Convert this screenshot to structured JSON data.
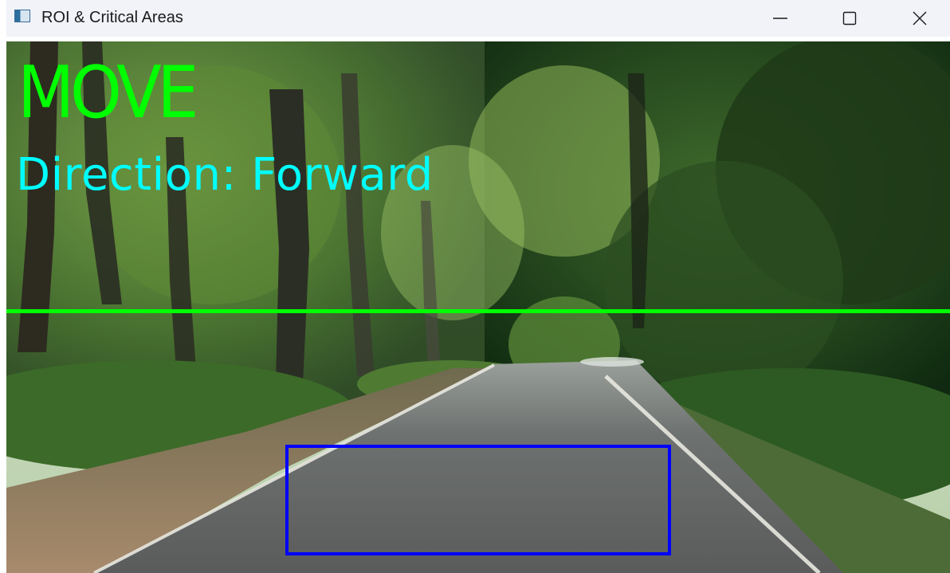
{
  "window": {
    "title": "ROI & Critical Areas",
    "icon": "app-window-icon",
    "controls": {
      "minimize_icon": "minimize-icon",
      "maximize_icon": "maximize-icon",
      "close_icon": "close-icon"
    }
  },
  "overlay": {
    "status": "MOVE",
    "direction": "Direction: Forward",
    "colors": {
      "status": "#00ff00",
      "direction": "#00ffff",
      "threshold_line": "#00ff00",
      "roi_box": "#0000ff"
    }
  }
}
